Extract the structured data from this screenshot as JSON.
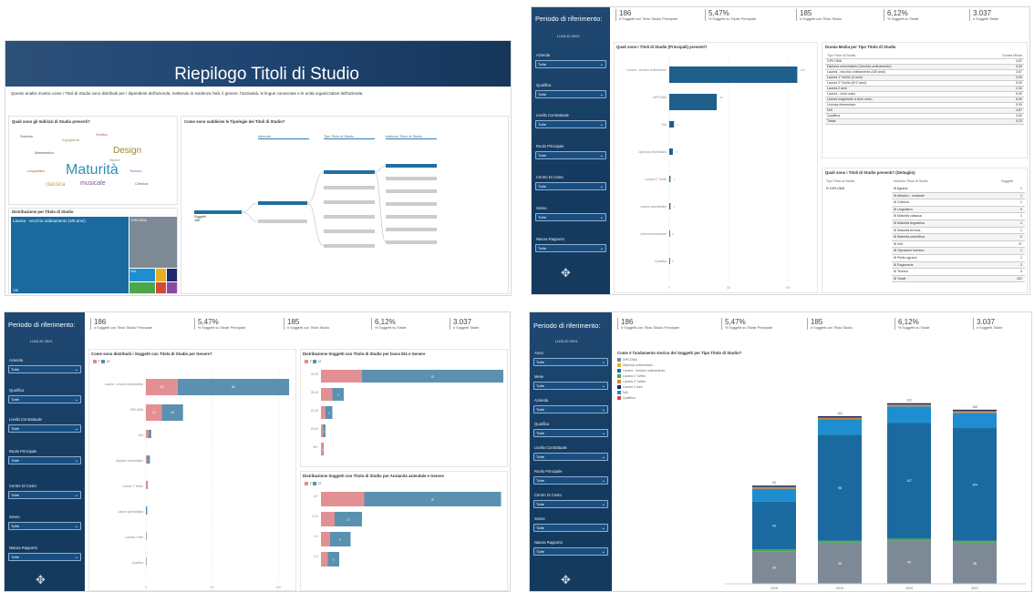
{
  "p1": {
    "title": "Riepilogo Titoli di Studio",
    "description": "Questo analisi mostra come i Titoli di Studio sono distribuiti per i dipendenti dell'azienda, mettendo in evidenza l'età, il genere, l'anzianità, le lingue conosciute e le unità organizzative dell'azienda.",
    "wordcloud_title": "Quali sono gli Indirizzi di Studio presenti?",
    "words": [
      "Maturità",
      "Design",
      "musicale",
      "classica",
      "Grafico",
      "Ingegneria",
      "Nuove",
      "Matematica",
      "Scienze",
      "Tecnico",
      "Linguistico",
      "Chimica"
    ],
    "tree_title": "Come sono suddivise le Tipologie dei Titoli di Studio?",
    "tree_filters": [
      "Azienda",
      "Tipo Titolo di Studio",
      "Indirizzo Titolo di Studio"
    ],
    "tree_root": "Soggetti",
    "tree_root_val": "185",
    "treemap_title": "Distribuzione per Titolo di Studio",
    "treemap_main": "Laurea - vecchio ordinamento (4/5 anni)",
    "treemap_second": "DIPLOMA",
    "treemap_na": "N/A",
    "treemap_val": "108"
  },
  "kpis": [
    {
      "v": "186",
      "l": "# Soggetti con Titolo Studio Principale"
    },
    {
      "v": "5,47%",
      "l": "% Soggetti su Totale Principale"
    },
    {
      "v": "185",
      "l": "# Soggetti con Titolo Studio"
    },
    {
      "v": "6,12%",
      "l": "% Soggetti su Totale"
    },
    {
      "v": "3.037",
      "l": "# Soggetti Totale"
    }
  ],
  "sidebar": {
    "title": "Periodo di riferimento:",
    "period": "LUGLIO 2021",
    "filters": [
      "Azienda",
      "Qualifica",
      "Livello Contrattuale",
      "Ruolo Principale",
      "Centro Di Costo",
      "Sesso",
      "Natura Rapporto"
    ],
    "value": "Tutte"
  },
  "sidebar4": {
    "filters": [
      "Anno",
      "Mese",
      "Azienda",
      "Qualifica",
      "Livello Contrattuale",
      "Ruolo Principale",
      "Centro Di Costo",
      "Sesso",
      "Natura Rapporto"
    ]
  },
  "p2": {
    "bar_title": "Quali sono i Titoli di Studio (Principali) presenti?",
    "cats": [
      "Laurea - vecchio ordinamento",
      "DIPLOMA",
      "N/A",
      "Diploma universitario",
      "Laurea 2° livello",
      "Laurea specialistica",
      "Licenza elementare",
      "Qualifica"
    ],
    "table_title": "Durata Media per Tipo Titolo di Studio",
    "table_head": [
      "Tipo Titolo di Studio",
      "Durata Media"
    ],
    "table_rows": [
      [
        "DIPLOMA",
        "4,87"
      ],
      [
        "Diploma universitario (Vecchio ordinamento)",
        "3,00"
      ],
      [
        "Laurea - vecchio ordinamento (4/5 anni)",
        "3,67"
      ],
      [
        "Laurea 1° livello (3 anni)",
        "3,00"
      ],
      [
        "Laurea 2° livello (5+2 anni)",
        "5,00"
      ],
      [
        "Laurea 2 anni",
        "2,00"
      ],
      [
        "Laurea - ciclo unico",
        "5,00"
      ],
      [
        "Laurea magistrale a ciclo unico",
        "6,00"
      ],
      [
        "Licenza elementare",
        "5,00"
      ],
      [
        "N/A",
        "4,87"
      ],
      [
        "Qualifica",
        "4,00"
      ],
      [
        "Totale",
        "5,23"
      ]
    ],
    "detail_title": "Quali sono i Titoli di Studio presenti? (Dettaglio)",
    "detail_head": [
      "Tipo Titolo di Studio",
      "Indirizzo Titolo di Studio",
      "Soggetti"
    ],
    "detail_type": "DIPLOMA",
    "detail_rows": [
      [
        "Agraria",
        "1"
      ],
      [
        "Artistico - musicale",
        "1"
      ],
      [
        "Chimica",
        "1"
      ],
      [
        "Linguistico",
        "4"
      ],
      [
        "Maturità classica",
        "1"
      ],
      [
        "Maturità linguistica",
        "1"
      ],
      [
        "Maturità tecnica",
        "1"
      ],
      [
        "Maturità scientifica",
        "2"
      ],
      [
        "N/A",
        "37"
      ],
      [
        "Operatore turistico",
        "1"
      ],
      [
        "Perito agrario",
        "1"
      ],
      [
        "Ragioneria",
        "2"
      ],
      [
        "Tecnico",
        "4"
      ],
      [
        "Totale",
        "102"
      ]
    ]
  },
  "p3": {
    "left_title": "Come sono distribuiti i Soggetti con Titolo di Studio per Genere?",
    "legend": [
      "F",
      "M"
    ],
    "cats": [
      "Laurea - vecchio ordinamento",
      "DIPLOMA",
      "N/A",
      "Diploma universitario",
      "Laurea 1° livello",
      "Laurea specialistica",
      "Laurea 2 anni",
      "Qualifica"
    ],
    "rt_title": "Distribuzione Soggetti con Titolo di Studio per fasce Età e Genere",
    "rb_title": "Distribuzione Soggetti con Titolo di Studio per Anzianità aziendale e Genere",
    "rt_cats": [
      "40-50",
      "30-40",
      "20-30",
      "50-60",
      "60+"
    ],
    "rb_cats": [
      "10+",
      "5-10",
      "2-5",
      "0-2"
    ]
  },
  "p4": {
    "title": "Come è l'andamento storico dei Soggetti per Tipo Titolo di Studio?",
    "legend": [
      "DIPLOMA",
      "Diploma universitario",
      "Laurea - vecchio ordinamento",
      "Laurea 1° livello",
      "Laurea 2° livello",
      "Laurea 2 anni",
      "N/A",
      "Qualifica"
    ],
    "years": [
      "2018",
      "2019",
      "2020",
      "2021"
    ],
    "totals": [
      "96",
      "182",
      "192",
      "188"
    ],
    "blue_vals": [
      "44",
      "98",
      "107",
      "104"
    ],
    "grey_vals": [
      "30",
      "38",
      "40",
      "38"
    ]
  },
  "chart_data": [
    {
      "type": "bar",
      "title": "Quali sono i Titoli di Studio (Principali) presenti?",
      "categories": [
        "Laurea - vecchio ordinamento",
        "DIPLOMA",
        "N/A",
        "Diploma universitario",
        "Laurea 2° livello",
        "Laurea specialistica",
        "Licenza elementare",
        "Qualifica"
      ],
      "values": [
        108,
        40,
        4,
        3,
        1,
        1,
        0,
        0
      ],
      "xlim": [
        0,
        120
      ]
    },
    {
      "type": "bar",
      "title": "Come sono distribuiti i Soggetti con Titolo di Studio per Genere?",
      "categories": [
        "Laurea - vecchio ordinamento",
        "DIPLOMA",
        "N/A",
        "Diploma universitario",
        "Laurea 1° livello",
        "Laurea specialistica",
        "Laurea 2 anni",
        "Qualifica"
      ],
      "series": [
        {
          "name": "F",
          "values": [
            24,
            12,
            2,
            1,
            1,
            0,
            0,
            0
          ]
        },
        {
          "name": "M",
          "values": [
            84,
            16,
            2,
            2,
            0,
            1,
            0,
            0
          ]
        }
      ]
    },
    {
      "type": "bar",
      "title": "Come è l'andamento storico dei Soggetti per Tipo Titolo di Studio?",
      "categories": [
        "2018",
        "2019",
        "2020",
        "2021"
      ],
      "series": [
        {
          "name": "DIPLOMA",
          "values": [
            30,
            38,
            40,
            38
          ]
        },
        {
          "name": "Laurea - vecchio ordinamento",
          "values": [
            44,
            98,
            107,
            104
          ]
        },
        {
          "name": "N/A",
          "values": [
            12,
            14,
            15,
            14
          ]
        }
      ]
    }
  ]
}
